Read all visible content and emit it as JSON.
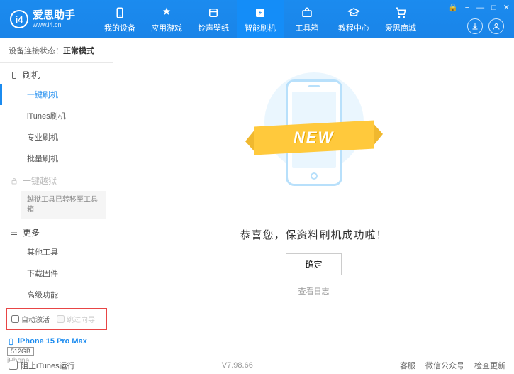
{
  "brand": {
    "name": "爱思助手",
    "url": "www.i4.cn",
    "logo_letter": "i4"
  },
  "nav": [
    {
      "label": "我的设备"
    },
    {
      "label": "应用游戏"
    },
    {
      "label": "铃声壁纸"
    },
    {
      "label": "智能刷机"
    },
    {
      "label": "工具箱"
    },
    {
      "label": "教程中心"
    },
    {
      "label": "爱思商城"
    }
  ],
  "conn": {
    "label": "设备连接状态：",
    "value": "正常模式"
  },
  "sidebar": {
    "section_flash": "刷机",
    "items_flash": [
      "一键刷机",
      "iTunes刷机",
      "专业刷机",
      "批量刷机"
    ],
    "section_jailbreak": "一键越狱",
    "jailbreak_note": "越狱工具已转移至工具箱",
    "section_more": "更多",
    "items_more": [
      "其他工具",
      "下载固件",
      "高级功能"
    ]
  },
  "side_checks": {
    "auto_activate": "自动激活",
    "skip_guide": "跳过向导"
  },
  "device": {
    "name": "iPhone 15 Pro Max",
    "storage": "512GB",
    "type": "iPhone"
  },
  "main": {
    "ribbon": "NEW",
    "success": "恭喜您，保资料刷机成功啦！",
    "confirm": "确定",
    "view_log": "查看日志"
  },
  "footer": {
    "block_itunes": "阻止iTunes运行",
    "version": "V7.98.66",
    "links": [
      "客服",
      "微信公众号",
      "检查更新"
    ]
  }
}
